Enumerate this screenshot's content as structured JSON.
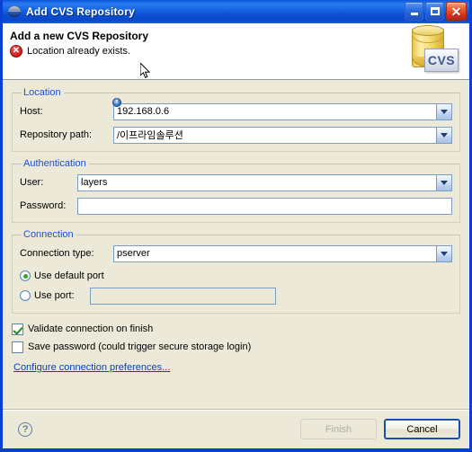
{
  "window": {
    "title": "Add CVS Repository",
    "title_icon": "eclipse-globe-icon",
    "minimize_label": "_",
    "maximize_label": "□",
    "close_label": "✕"
  },
  "header": {
    "title": "Add a new CVS Repository",
    "message": "Location already exists.",
    "message_icon": "error-icon",
    "error_glyph": "✕",
    "logo_text": "CVS",
    "logo_icon": "cvs-database-icon"
  },
  "location": {
    "legend": "Location",
    "host_label": "Host:",
    "host_value": "192.168.0.6",
    "host_info_glyph": "i",
    "repo_label": "Repository path:",
    "repo_value": "/이프라임솔루션"
  },
  "authentication": {
    "legend": "Authentication",
    "user_label": "User:",
    "user_value": "layers",
    "password_label": "Password:",
    "password_value": "",
    "password_placeholder": ""
  },
  "connection": {
    "legend": "Connection",
    "type_label": "Connection type:",
    "type_value": "pserver",
    "use_default_port_label": "Use default port",
    "use_default_port_checked": true,
    "use_port_label": "Use port:",
    "use_port_checked": false,
    "port_value": "",
    "port_enabled": false
  },
  "options": {
    "validate_label": "Validate connection on finish",
    "validate_checked": true,
    "save_password_label": "Save password (could trigger secure storage login)",
    "save_password_checked": false,
    "preferences_link": "Configure connection preferences..."
  },
  "footer": {
    "help_glyph": "?",
    "finish_label": "Finish",
    "finish_enabled": false,
    "cancel_label": "Cancel"
  },
  "colors": {
    "title_bar": "#1461E0",
    "dialog_bg": "#ECE9D8",
    "group_legend": "#1D4FD8",
    "link": "#0B3FBE",
    "error": "#D4201F",
    "check_green": "#1F8A1F",
    "frame_border": "#0A3FD4"
  }
}
